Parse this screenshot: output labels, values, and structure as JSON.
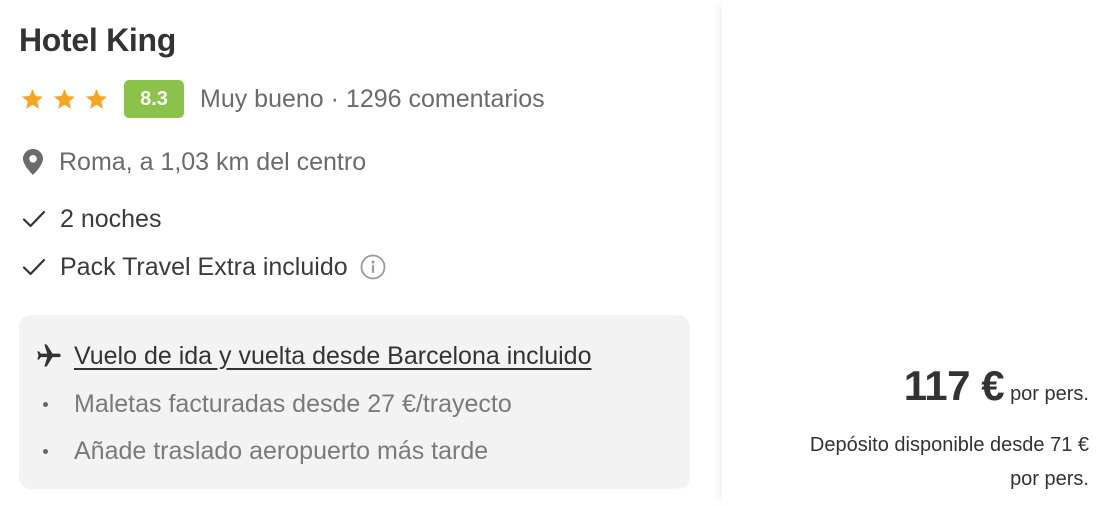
{
  "hotel": {
    "name": "Hotel King",
    "stars": 3,
    "score": "8.3",
    "rating_text": "Muy bueno · 1296 comentarios",
    "location": "Roma, a 1,03 km del centro",
    "features": [
      "2 noches",
      "Pack Travel Extra incluido"
    ]
  },
  "flight": {
    "title": "Vuelo de ida y vuelta desde Barcelona incluido",
    "details": [
      "Maletas facturadas desde 27 €/trayecto",
      "Añade traslado aeropuerto más tarde"
    ]
  },
  "price": {
    "amount": "117 €",
    "per_person": "por pers.",
    "deposit_line1": "Depósito disponible desde 71 €",
    "deposit_line2": "por pers."
  },
  "colors": {
    "star": "#f5a623",
    "score_bg": "#8bc34a",
    "flight_box_bg": "#f3f3f3"
  },
  "icons": {
    "star": "star-icon",
    "location": "map-pin-icon",
    "check": "check-icon",
    "info": "info-icon",
    "plane": "plane-icon"
  }
}
